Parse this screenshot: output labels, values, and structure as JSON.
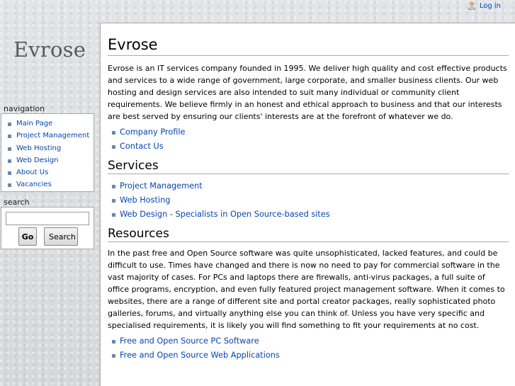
{
  "personal": {
    "login_label": "Log in"
  },
  "logo": {
    "text": "Evrose"
  },
  "navigation": {
    "title": "navigation",
    "items": [
      {
        "label": "Main Page"
      },
      {
        "label": "Project Management"
      },
      {
        "label": "Web Hosting"
      },
      {
        "label": "Web Design"
      },
      {
        "label": "About Us"
      },
      {
        "label": "Vacancies"
      }
    ]
  },
  "search": {
    "title": "search",
    "input_value": "",
    "go_label": "Go",
    "search_label": "Search"
  },
  "content": {
    "title": "Evrose",
    "intro": "Evrose is an IT services company founded in 1995. We deliver high quality and cost effective products and services to a wide range of government, large corporate, and smaller business clients. Our web hosting and design services are also intended to suit many individual or community client requirements. We believe firmly in an honest and ethical approach to business and that our interests are best served by ensuring our clients' interests are at the forefront of whatever we do.",
    "profile_links": [
      {
        "label": "Company Profile"
      },
      {
        "label": "Contact Us"
      }
    ],
    "services_heading": "Services",
    "services_links": [
      {
        "label": "Project Management"
      },
      {
        "label": "Web Hosting"
      },
      {
        "label": "Web Design - Specialists in Open Source-based sites"
      }
    ],
    "resources_heading": "Resources",
    "resources_text": "In the past free and Open Source software was quite unsophisticated, lacked features, and could be difficult to use. Times have changed and there is now no need to pay for commercial software in the vast majority of cases. For PCs and laptops there are firewalls, anti-virus packages, a full suite of office programs, encryption, and even fully featured project management software. When it comes to websites, there are a range of different site and portal creator packages, really sophisticated photo galleries, forums, and virtually anything else you can think of. Unless you have very specific and specialised requirements, it is likely you will find something to fit your requirements at no cost.",
    "resources_links": [
      {
        "label": "Free and Open Source PC Software"
      },
      {
        "label": "Free and Open Source Web Applications"
      }
    ]
  },
  "colors": {
    "link": "#0645ad",
    "bullet": "#6c87ad",
    "border": "#aaaaaa"
  }
}
